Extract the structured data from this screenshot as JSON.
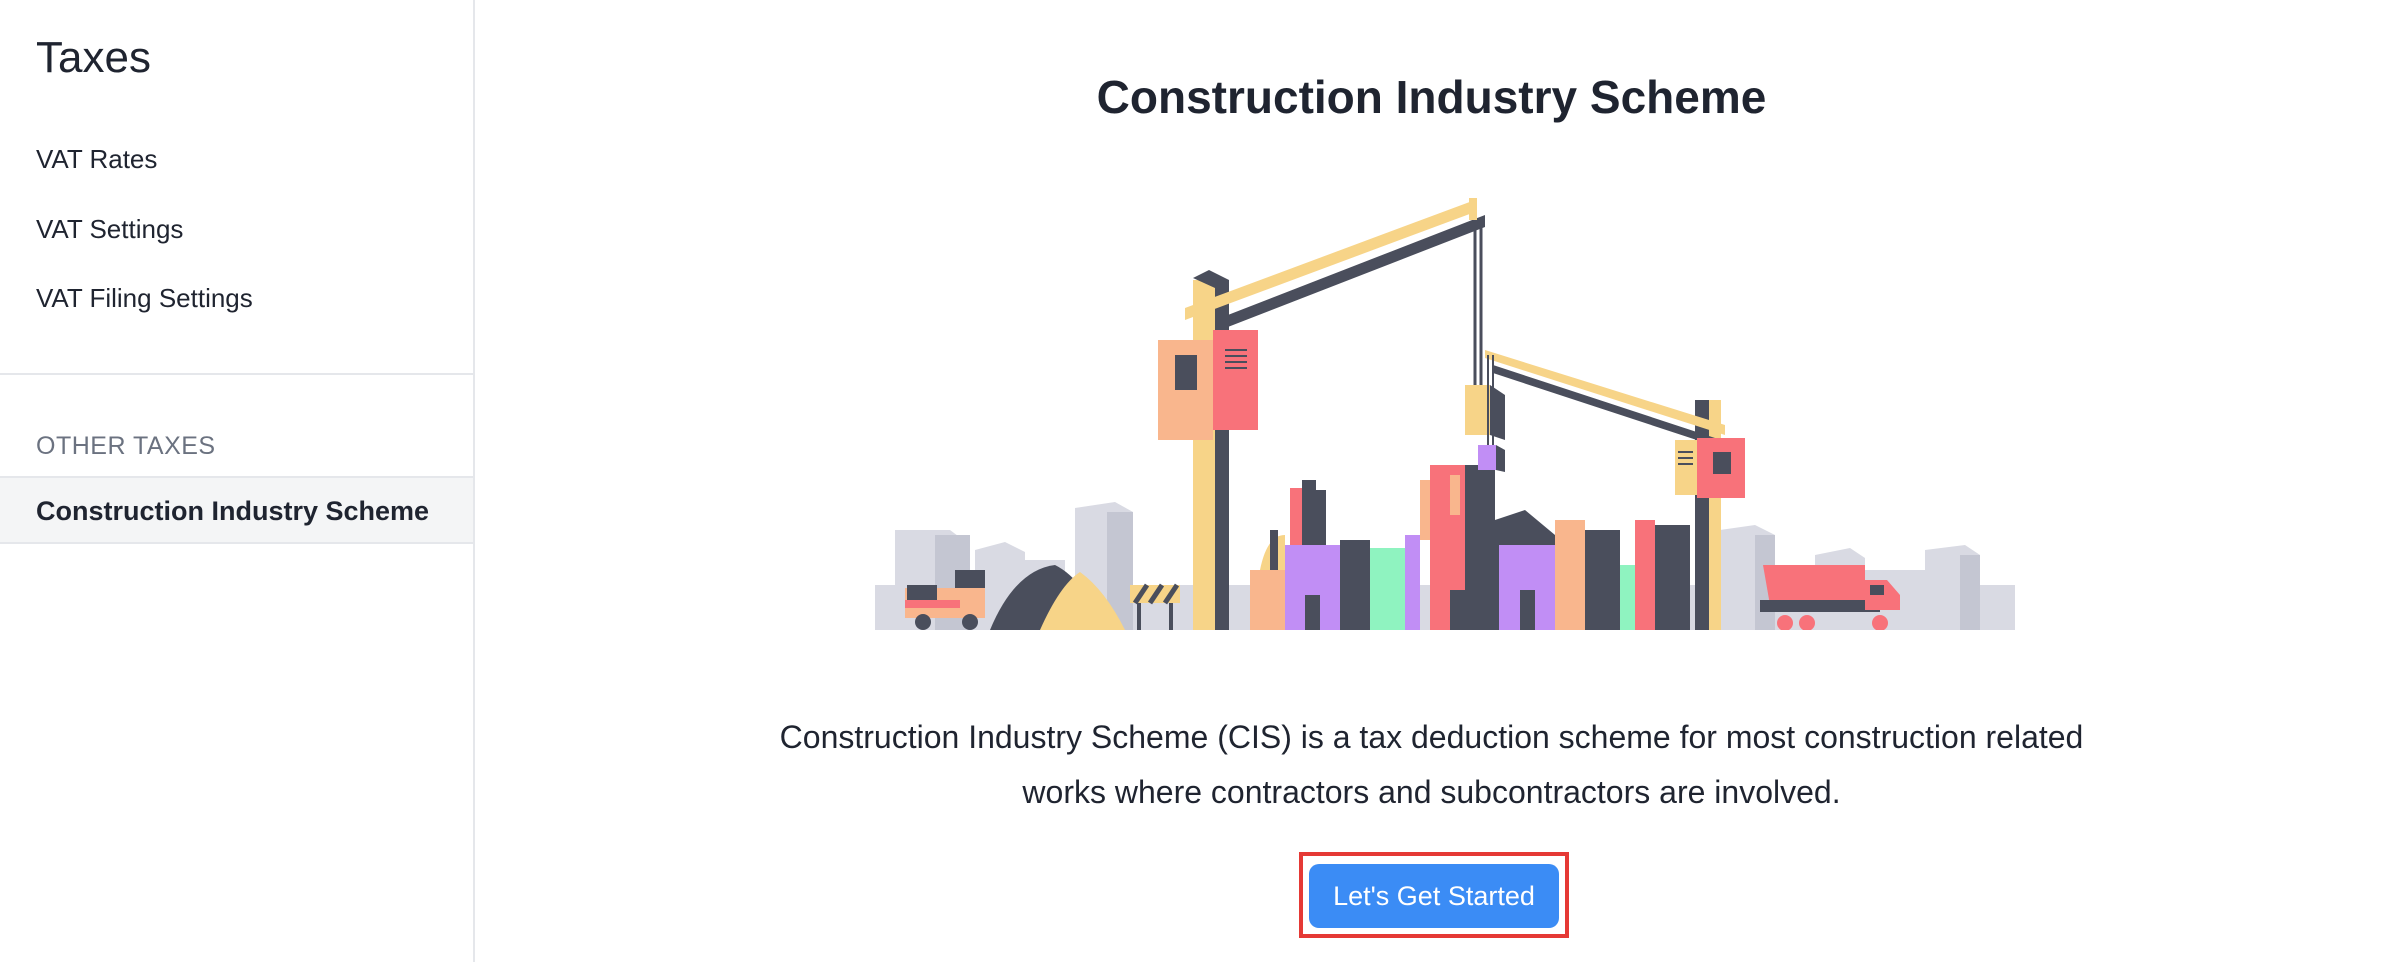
{
  "sidebar": {
    "title": "Taxes",
    "items": [
      {
        "label": "VAT Rates"
      },
      {
        "label": "VAT Settings"
      },
      {
        "label": "VAT Filing Settings"
      }
    ],
    "section_heading": "OTHER TAXES",
    "active_item": {
      "label": "Construction Industry Scheme"
    }
  },
  "main": {
    "title": "Construction Industry Scheme",
    "description_line1": "Construction Industry Scheme (CIS) is a tax deduction scheme for most construction related",
    "description_line2": "works where contractors and subcontractors are involved.",
    "cta_label": "Let's Get Started"
  },
  "colors": {
    "accent": "#3b8cf5",
    "highlight_border": "#e53935",
    "crane_yellow": "#f7d488",
    "dark_slate": "#4a4e5c",
    "coral": "#f8727a",
    "peach": "#f9b68d",
    "purple": "#c18ef5",
    "mint": "#8ff3c0",
    "light_gray": "#d9dae3"
  }
}
